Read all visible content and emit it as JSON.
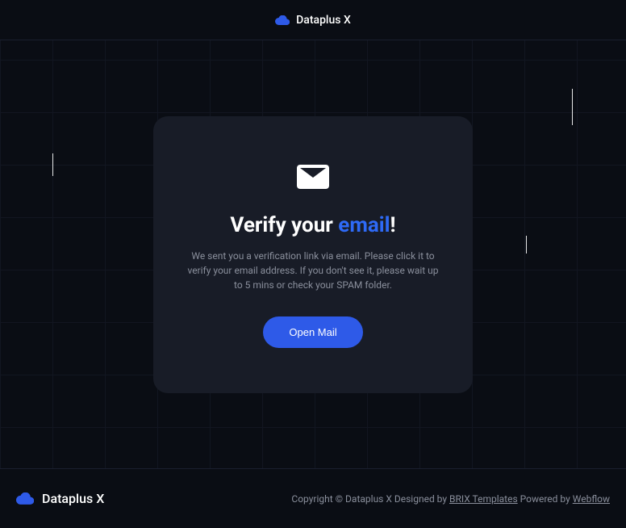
{
  "header": {
    "brand_name": "Dataplus X"
  },
  "card": {
    "title_prefix": "Verify your ",
    "title_highlight": "email",
    "title_suffix": "!",
    "description": "We sent you a verification link via email. Please click it to verify your email address. If you don't see it, please wait up to  5 mins or check your SPAM folder.",
    "button_label": "Open Mail"
  },
  "footer": {
    "brand_name": "Dataplus X",
    "copyright_text": "Copyright © Dataplus X ",
    "designed_by_label": "Designed by ",
    "designed_by_link": "BRIX Templates",
    "powered_by_label": " Powered by ",
    "powered_by_link": "Webflow"
  }
}
